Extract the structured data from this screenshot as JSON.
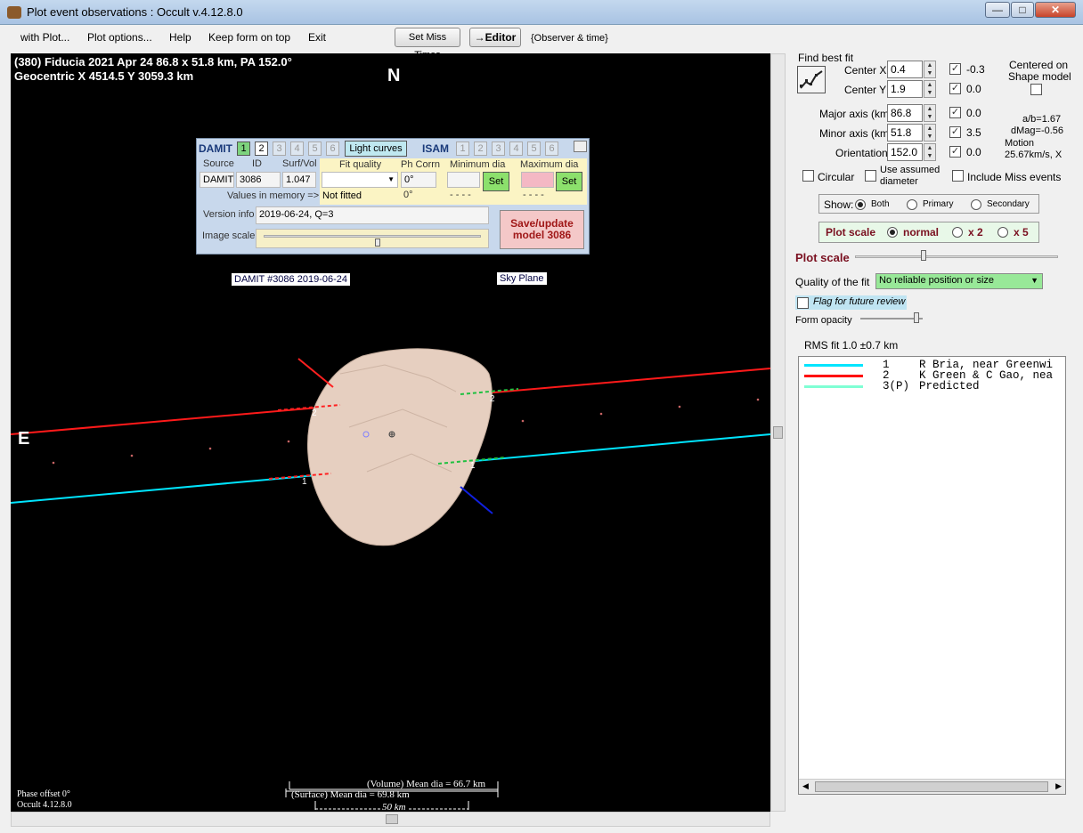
{
  "window": {
    "title": "Plot event observations : Occult v.4.12.8.0"
  },
  "menu": {
    "items": [
      "with Plot...",
      "Plot options...",
      "Help",
      "Keep form on top",
      "Exit"
    ],
    "set_miss_times": "Set Miss Times",
    "editor": "→Editor",
    "observer_time": "{Observer & time}"
  },
  "plot": {
    "header_line1": "(380) Fiducia  2021 Apr 24   86.8 x 51.8 km,  PA 152.0°",
    "header_line2": "Geocentric  X  4514.5  Y 3059.3 km",
    "north": "N",
    "east": "E",
    "damit_label": "DAMIT #3086 2019-06-24",
    "sky_plane": "Sky Plane",
    "volume_mean": "(Volume) Mean dia = 66.7 km",
    "surface_mean": "(Surface) Mean dia = 69.8 km",
    "scale": "50 km",
    "phase_offset": "Phase offset 0°",
    "version": "Occult 4.12.8.0",
    "chord_labels": [
      "2",
      "2",
      "1",
      "1"
    ]
  },
  "damit": {
    "damit_title": "DAMIT",
    "isam_title": "ISAM",
    "numbers": [
      "1",
      "2",
      "3",
      "4",
      "5",
      "6"
    ],
    "light_curves": "Light curves",
    "hdr_source": "Source",
    "hdr_id": "ID",
    "hdr_surf": "Surf/Vol",
    "hdr_fit": "Fit quality",
    "hdr_ph": "Ph Corrn",
    "hdr_min": "Minimum dia",
    "hdr_max": "Maximum dia",
    "source": "DAMIT",
    "id": "3086",
    "surf_vol": "1.047",
    "ph_corr": "0°",
    "set": "Set",
    "values_in_memory": "Values in memory =>",
    "not_fitted": "Not fitted",
    "mem_ph": "0°",
    "mem_min": "- - - -",
    "mem_max": "- - - -",
    "version_info_label": "Version info",
    "version_info": "2019-06-24, Q=3",
    "image_scale": "Image scale",
    "save_update": "Save/update",
    "save_model": "model 3086"
  },
  "panel": {
    "find_best_fit": "Find best fit",
    "center_x_label": "Center X",
    "center_x": "0.4",
    "center_x_delta": "-0.3",
    "center_y_label": "Center Y",
    "center_y": "1.9",
    "center_y_delta": "0.0",
    "major_label": "Major axis (km)",
    "major": "86.8",
    "major_delta": "0.0",
    "minor_label": "Minor axis (km)",
    "minor": "51.8",
    "minor_delta": "3.5",
    "orient_label": "Orientation",
    "orient": "152.0",
    "orient_delta": "0.0",
    "centered_on": "Centered on",
    "shape_model": "Shape model",
    "ab": "a/b=1.67",
    "dmag": "dMag=-0.56",
    "motion_label": "Motion",
    "motion": "25.67km/s, X",
    "circular": "Circular",
    "use_assumed_1": "Use assumed",
    "use_assumed_2": "diameter",
    "include_miss": "Include Miss events",
    "show_label": "Show:",
    "show_both": "Both",
    "show_primary": "Primary",
    "show_secondary": "Secondary",
    "plot_scale_label": "Plot scale",
    "ps_normal": "normal",
    "ps_x2": "x 2",
    "ps_x5": "x 5",
    "plot_scale_slider": "Plot scale",
    "quality_label": "Quality of the fit",
    "quality": "No reliable position or size",
    "flag_review": "Flag for future review",
    "form_opacity": "Form opacity",
    "rms_fit": "RMS fit  1.0 ±0.7 km"
  },
  "legend": [
    {
      "num": "1",
      "text": "R Bria, near Greenwi",
      "color": "#00e5ff"
    },
    {
      "num": "2",
      "text": "K Green & C Gao, nea",
      "color": "#ff0000"
    },
    {
      "num": "3(P)",
      "text": "Predicted",
      "color": "#7fffd4"
    }
  ]
}
